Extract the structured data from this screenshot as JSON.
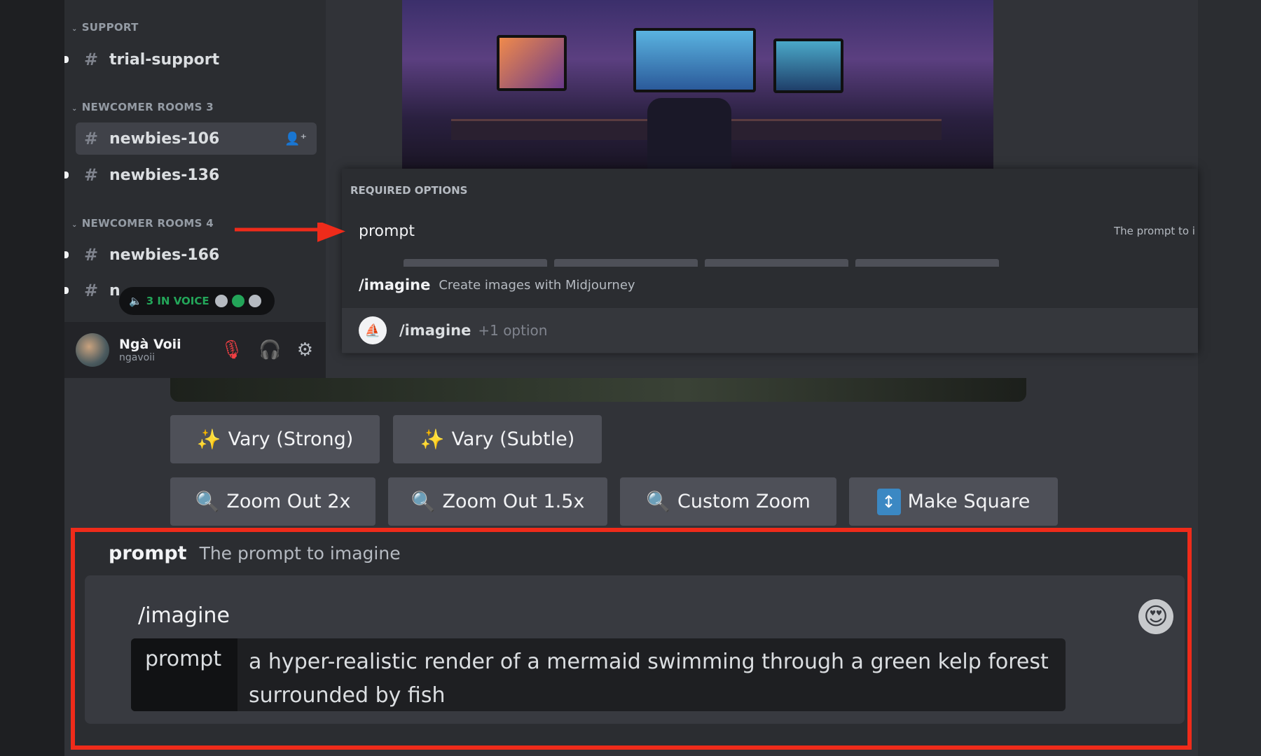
{
  "sidebar": {
    "categories": [
      {
        "label": "SUPPORT"
      },
      {
        "label": "NEWCOMER ROOMS 3"
      },
      {
        "label": "NEWCOMER ROOMS 4"
      }
    ],
    "channels": [
      {
        "label": "trial-support"
      },
      {
        "label": "newbies-106"
      },
      {
        "label": "newbies-136"
      },
      {
        "label": "newbies-166"
      },
      {
        "label": "n"
      }
    ],
    "voice": {
      "label": "3 IN VOICE"
    },
    "user": {
      "name": "Ngà Voii",
      "tag": "ngavoii"
    }
  },
  "popup": {
    "required_header": "REQUIRED OPTIONS",
    "option_name": "prompt",
    "option_desc": "The prompt to i",
    "command": "/imagine",
    "command_desc": "Create images with Midjourney",
    "row_command": "/imagine",
    "row_options": "+1 option"
  },
  "buttons": {
    "vary_strong": "Vary (Strong)",
    "vary_subtle": "Vary (Subtle)",
    "zoom_out_2x": "Zoom Out 2x",
    "zoom_out_15x": "Zoom Out 1.5x",
    "custom_zoom": "Custom Zoom",
    "make_square": "Make Square"
  },
  "composer": {
    "hint_name": "prompt",
    "hint_desc": "The prompt to imagine",
    "command": "/imagine",
    "param_label": "prompt",
    "param_value": "a hyper-realistic render of a mermaid swimming through a green kelp forest surrounded by fish"
  },
  "colors": {
    "highlight": "#ef2b1a",
    "voice": "#23a559"
  }
}
